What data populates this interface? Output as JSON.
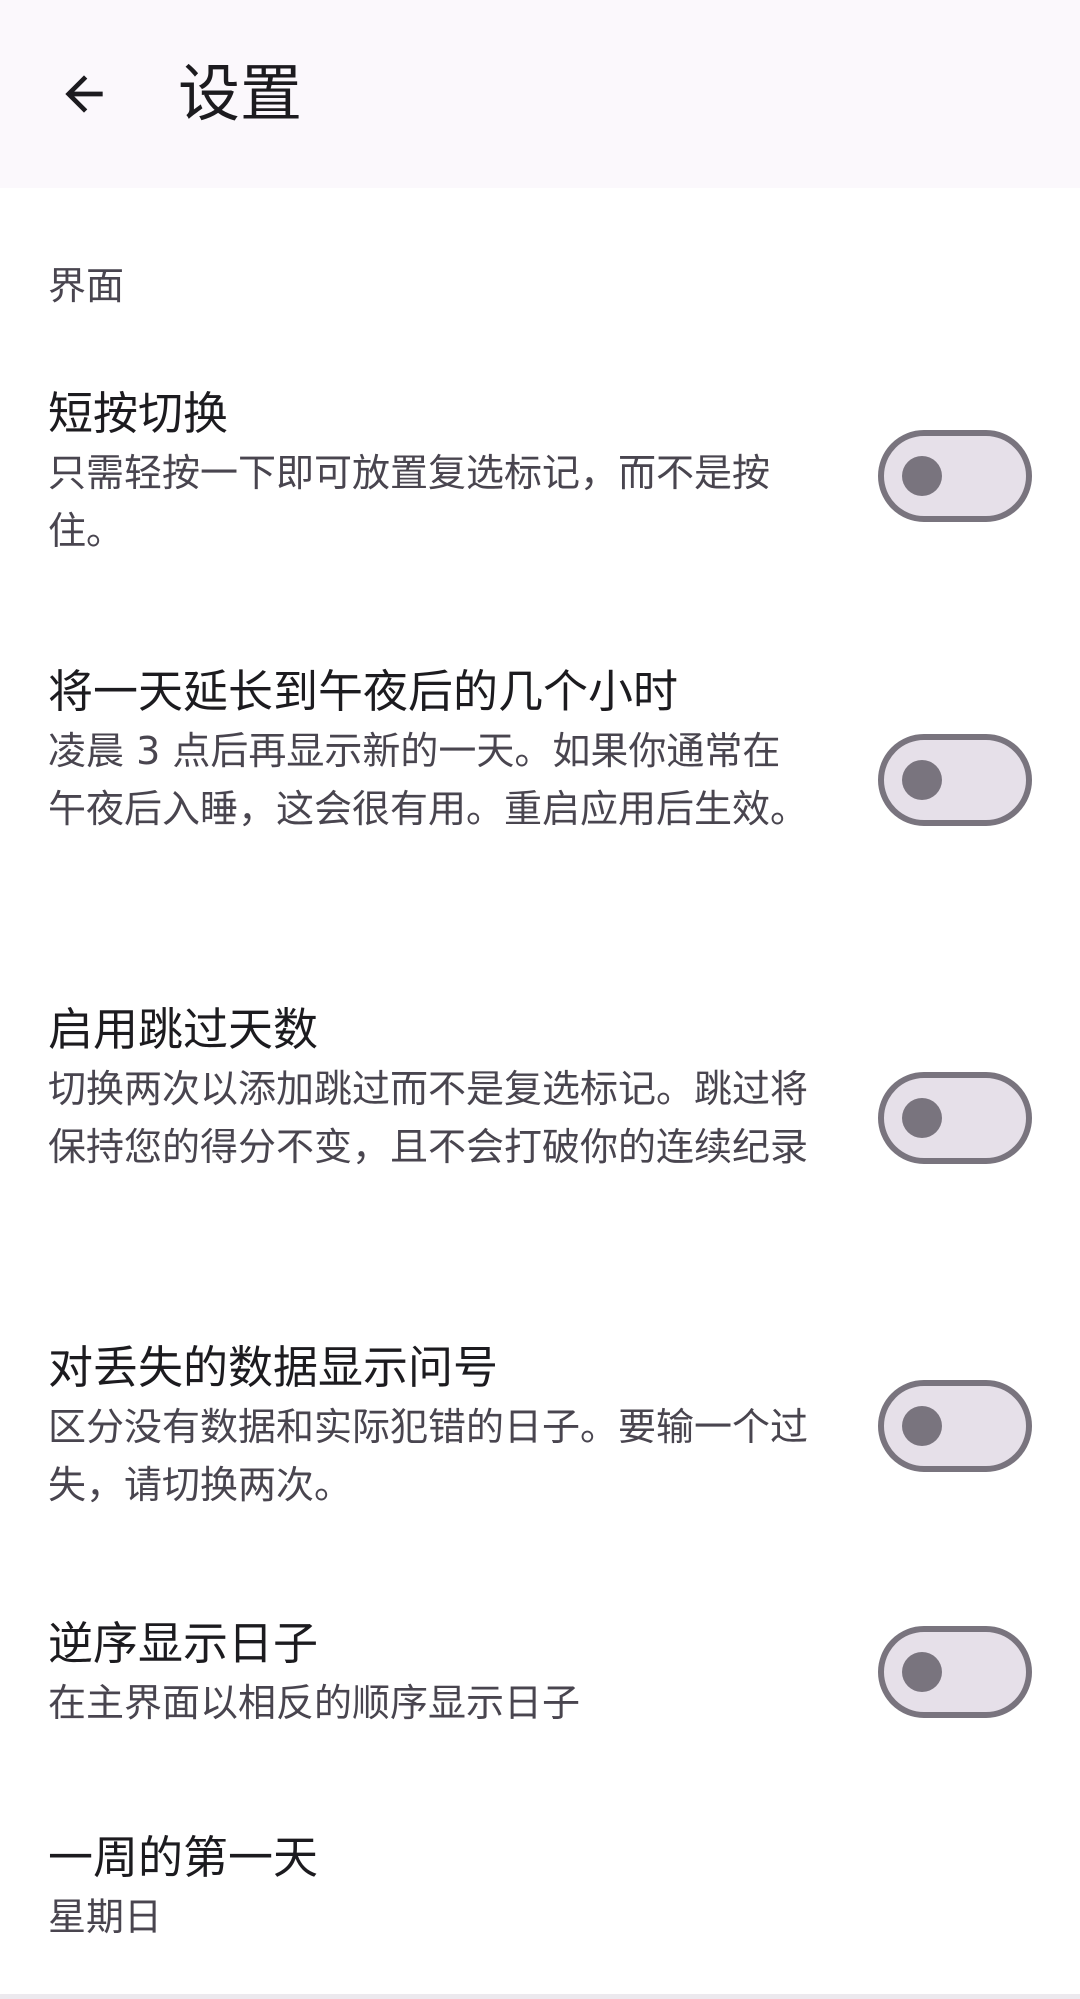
{
  "app_bar": {
    "title": "设置",
    "back_icon": "arrow-left-icon"
  },
  "section": {
    "title": "界面"
  },
  "settings": [
    {
      "title": "短按切换",
      "summary": "只需轻按一下即可放置复选标记，而不是按住。",
      "toggle_on": false
    },
    {
      "title": "将一天延长到午夜后的几个小时",
      "summary": "凌晨 3 点后再显示新的一天。如果你通常在午夜后入睡，这会很有用。重启应用后生效。",
      "toggle_on": false
    },
    {
      "title": "启用跳过天数",
      "summary": "切换两次以添加跳过而不是复选标记。跳过将保持您的得分不变，且不会打破你的连续纪录",
      "toggle_on": false
    },
    {
      "title": "对丢失的数据显示问号",
      "summary": "区分没有数据和实际犯错的日子。要输一个过失，请切换两次。",
      "toggle_on": false
    },
    {
      "title": "逆序显示日子",
      "summary": "在主界面以相反的顺序显示日子",
      "toggle_on": false
    },
    {
      "title": "一周的第一天",
      "summary": "星期日"
    }
  ],
  "colors": {
    "app_bar_bg": "#fbf8fc",
    "switch_track": "#e6e0e9",
    "switch_outline": "#79747e",
    "secondary_text": "#49454f"
  }
}
